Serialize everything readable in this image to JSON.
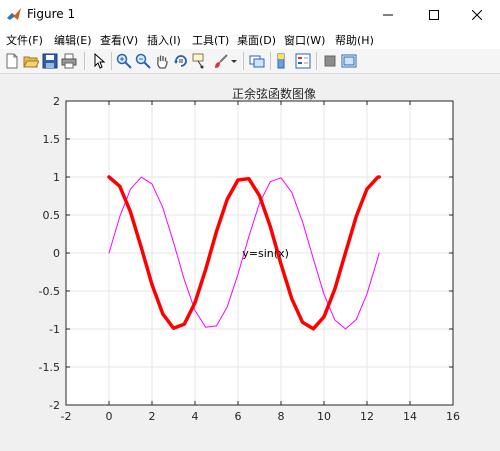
{
  "window": {
    "title": "Figure 1",
    "minimize_icon": "minimize-icon",
    "maximize_icon": "maximize-icon",
    "close_icon": "close-icon"
  },
  "menu": [
    {
      "label": "文件(F)"
    },
    {
      "label": "编辑(E)"
    },
    {
      "label": "查看(V)"
    },
    {
      "label": "插入(I)"
    },
    {
      "label": "工具(T)"
    },
    {
      "label": "桌面(D)"
    },
    {
      "label": "窗口(W)"
    },
    {
      "label": "帮助(H)"
    }
  ],
  "toolbar": [
    {
      "icon": "new-figure-icon"
    },
    {
      "icon": "open-file-icon"
    },
    {
      "icon": "save-icon"
    },
    {
      "icon": "print-icon"
    },
    {
      "icon": "edit-plot-arrow-icon"
    },
    {
      "icon": "zoom-in-icon"
    },
    {
      "icon": "zoom-out-icon"
    },
    {
      "icon": "pan-hand-icon"
    },
    {
      "icon": "rotate-3d-icon"
    },
    {
      "icon": "data-cursor-icon"
    },
    {
      "icon": "brush-icon"
    },
    {
      "icon": "brush-dropdown-icon"
    },
    {
      "icon": "link-plot-icon"
    },
    {
      "icon": "colorbar-icon"
    },
    {
      "icon": "legend-icon"
    },
    {
      "icon": "hide-plot-tools-icon"
    },
    {
      "icon": "show-plot-tools-icon"
    }
  ],
  "colors": {
    "sin_curve": "#ff00ff",
    "cos_curve": "#ff0000",
    "grid": "#e6e6e6",
    "axes_background": "#ffffff"
  },
  "chart_data": {
    "type": "line",
    "title": "正余弦函数图像",
    "xlabel": "",
    "ylabel": "",
    "xlim": [
      -2,
      16
    ],
    "ylim": [
      -2,
      2
    ],
    "xticks": [
      -2,
      0,
      2,
      4,
      6,
      8,
      10,
      12,
      14,
      16
    ],
    "yticks": [
      -2,
      -1.5,
      -1,
      -0.5,
      0,
      0.5,
      1,
      1.5,
      2
    ],
    "xtick_labels": [
      "-2",
      "0",
      "2",
      "4",
      "6",
      "8",
      "10",
      "12",
      "14",
      "16"
    ],
    "ytick_labels": [
      "-2",
      "-1.5",
      "-1",
      "-0.5",
      "0",
      "0.5",
      "1",
      "1.5",
      "2"
    ],
    "grid": true,
    "x": [
      0,
      0.5,
      1,
      1.5,
      2,
      2.5,
      3,
      3.5,
      4,
      4.5,
      5,
      5.5,
      6,
      6.5,
      7,
      7.5,
      8,
      8.5,
      9,
      9.5,
      10,
      10.5,
      11,
      11.5,
      12,
      12.5,
      12.566
    ],
    "series": [
      {
        "values": [
          0,
          0.479,
          0.841,
          0.997,
          0.909,
          0.598,
          0.141,
          -0.351,
          -0.757,
          -0.978,
          -0.959,
          -0.706,
          -0.279,
          0.215,
          0.657,
          0.938,
          0.989,
          0.798,
          0.412,
          -0.075,
          -0.544,
          -0.88,
          -1.0,
          -0.875,
          -0.537,
          -0.066,
          0
        ],
        "color": "#ff00ff",
        "line_width": "thin"
      },
      {
        "values": [
          1,
          0.878,
          0.54,
          0.071,
          -0.416,
          -0.801,
          -0.99,
          -0.936,
          -0.654,
          -0.211,
          0.284,
          0.709,
          0.96,
          0.977,
          0.754,
          0.347,
          -0.146,
          -0.602,
          -0.911,
          -0.997,
          -0.839,
          -0.476,
          0.004,
          0.483,
          0.844,
          0.998,
          1
        ],
        "color": "#ff0000",
        "line_width": "thick"
      }
    ],
    "annotations": [
      {
        "text": "y=sin(x)",
        "x": 6.2,
        "y": 0
      }
    ]
  }
}
